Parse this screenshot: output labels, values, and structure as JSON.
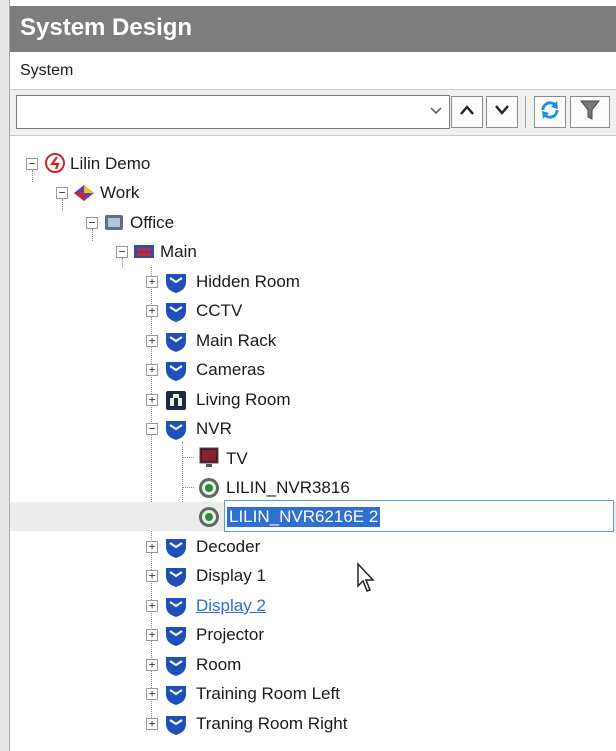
{
  "window": {
    "title": "System Design"
  },
  "menu": {
    "system_label": "System"
  },
  "toolbar": {
    "combo_value": "",
    "combo_arrow_icon": "chevron-down-icon",
    "up_icon": "arrow-up-icon",
    "down_icon": "arrow-down-icon",
    "refresh_icon": "refresh-icon",
    "filter_icon": "filter-icon"
  },
  "tree": {
    "root": {
      "label": "Lilin Demo",
      "icon": "lilin-logo-icon"
    },
    "work": {
      "label": "Work",
      "icon": "work-icon"
    },
    "office": {
      "label": "Office",
      "icon": "office-icon"
    },
    "main": {
      "label": "Main",
      "icon": "main-rack-icon"
    },
    "items": [
      {
        "label": "Hidden Room",
        "icon": "shield-icon"
      },
      {
        "label": "CCTV",
        "icon": "shield-icon"
      },
      {
        "label": "Main Rack",
        "icon": "shield-icon"
      },
      {
        "label": "Cameras",
        "icon": "shield-icon"
      },
      {
        "label": "Living Room",
        "icon": "room-icon"
      },
      {
        "label": "NVR",
        "icon": "shield-icon"
      }
    ],
    "nvr_children": [
      {
        "label": "TV",
        "icon": "tv-icon"
      },
      {
        "label": "LILIN_NVR3816",
        "icon": "nvr-icon"
      },
      {
        "label": "LILIN_NVR6216E 2",
        "icon": "nvr-icon",
        "editing": true
      }
    ],
    "items_after": [
      {
        "label": "Decoder",
        "icon": "shield-icon"
      },
      {
        "label": "Display 1",
        "icon": "shield-icon"
      },
      {
        "label": "Display 2",
        "icon": "shield-icon",
        "link": true
      },
      {
        "label": "Projector",
        "icon": "shield-icon"
      },
      {
        "label": "Room",
        "icon": "shield-icon"
      },
      {
        "label": "Training Room Left",
        "icon": "shield-icon"
      },
      {
        "label": "Traning Room Right",
        "icon": "shield-icon"
      }
    ]
  },
  "colors": {
    "titlebar": "#7d7d7d",
    "selection": "#2f6fd0",
    "shield": "#1f4fb8",
    "link": "#2a6fd6"
  }
}
